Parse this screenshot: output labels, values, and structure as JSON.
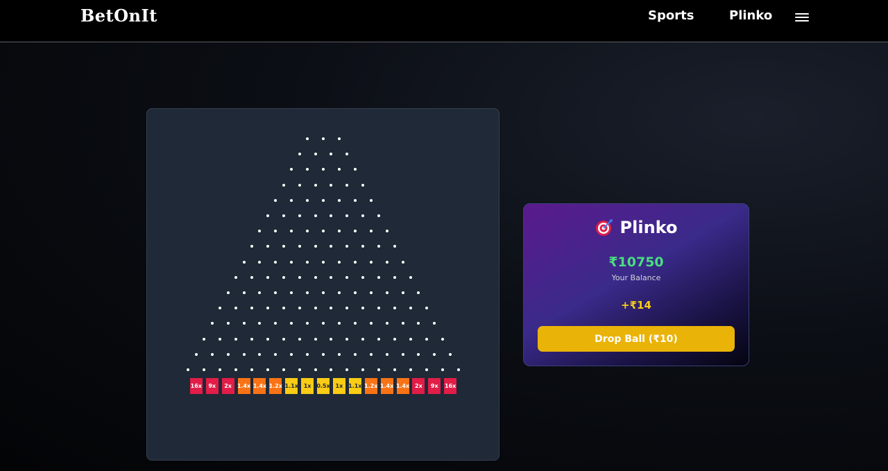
{
  "nav": {
    "brand": "BetOnIt",
    "links": [
      "Sports",
      "Plinko"
    ],
    "menu_icon": "hamburger-menu-icon"
  },
  "board": {
    "rows": 16,
    "first_row_pegs": 3,
    "slots": [
      {
        "label": "16x",
        "color": "#e11d48"
      },
      {
        "label": "9x",
        "color": "#e11d48"
      },
      {
        "label": "2x",
        "color": "#e11d48"
      },
      {
        "label": "1.4x",
        "color": "#f97316"
      },
      {
        "label": "1.4x",
        "color": "#f97316"
      },
      {
        "label": "1.2x",
        "color": "#f97316"
      },
      {
        "label": "1.1x",
        "color": "#facc15"
      },
      {
        "label": "1x",
        "color": "#facc15"
      },
      {
        "label": "0.5x",
        "color": "#facc15"
      },
      {
        "label": "1x",
        "color": "#facc15"
      },
      {
        "label": "1.1x",
        "color": "#facc15"
      },
      {
        "label": "1.2x",
        "color": "#f97316"
      },
      {
        "label": "1.4x",
        "color": "#f97316"
      },
      {
        "label": "1.4x",
        "color": "#f97316"
      },
      {
        "label": "2x",
        "color": "#e11d48"
      },
      {
        "label": "9x",
        "color": "#e11d48"
      },
      {
        "label": "16x",
        "color": "#e11d48"
      }
    ]
  },
  "panel": {
    "icon": "target-dart-icon",
    "title": "Plinko",
    "balance": "₹10750",
    "balance_label": "Your Balance",
    "last_win": "+₹14",
    "drop_button_label": "Drop Ball (₹10)"
  },
  "colors": {
    "balance": "#4ade80",
    "win": "#facc15",
    "button": "#eab308",
    "board_bg": "#1f2937"
  }
}
